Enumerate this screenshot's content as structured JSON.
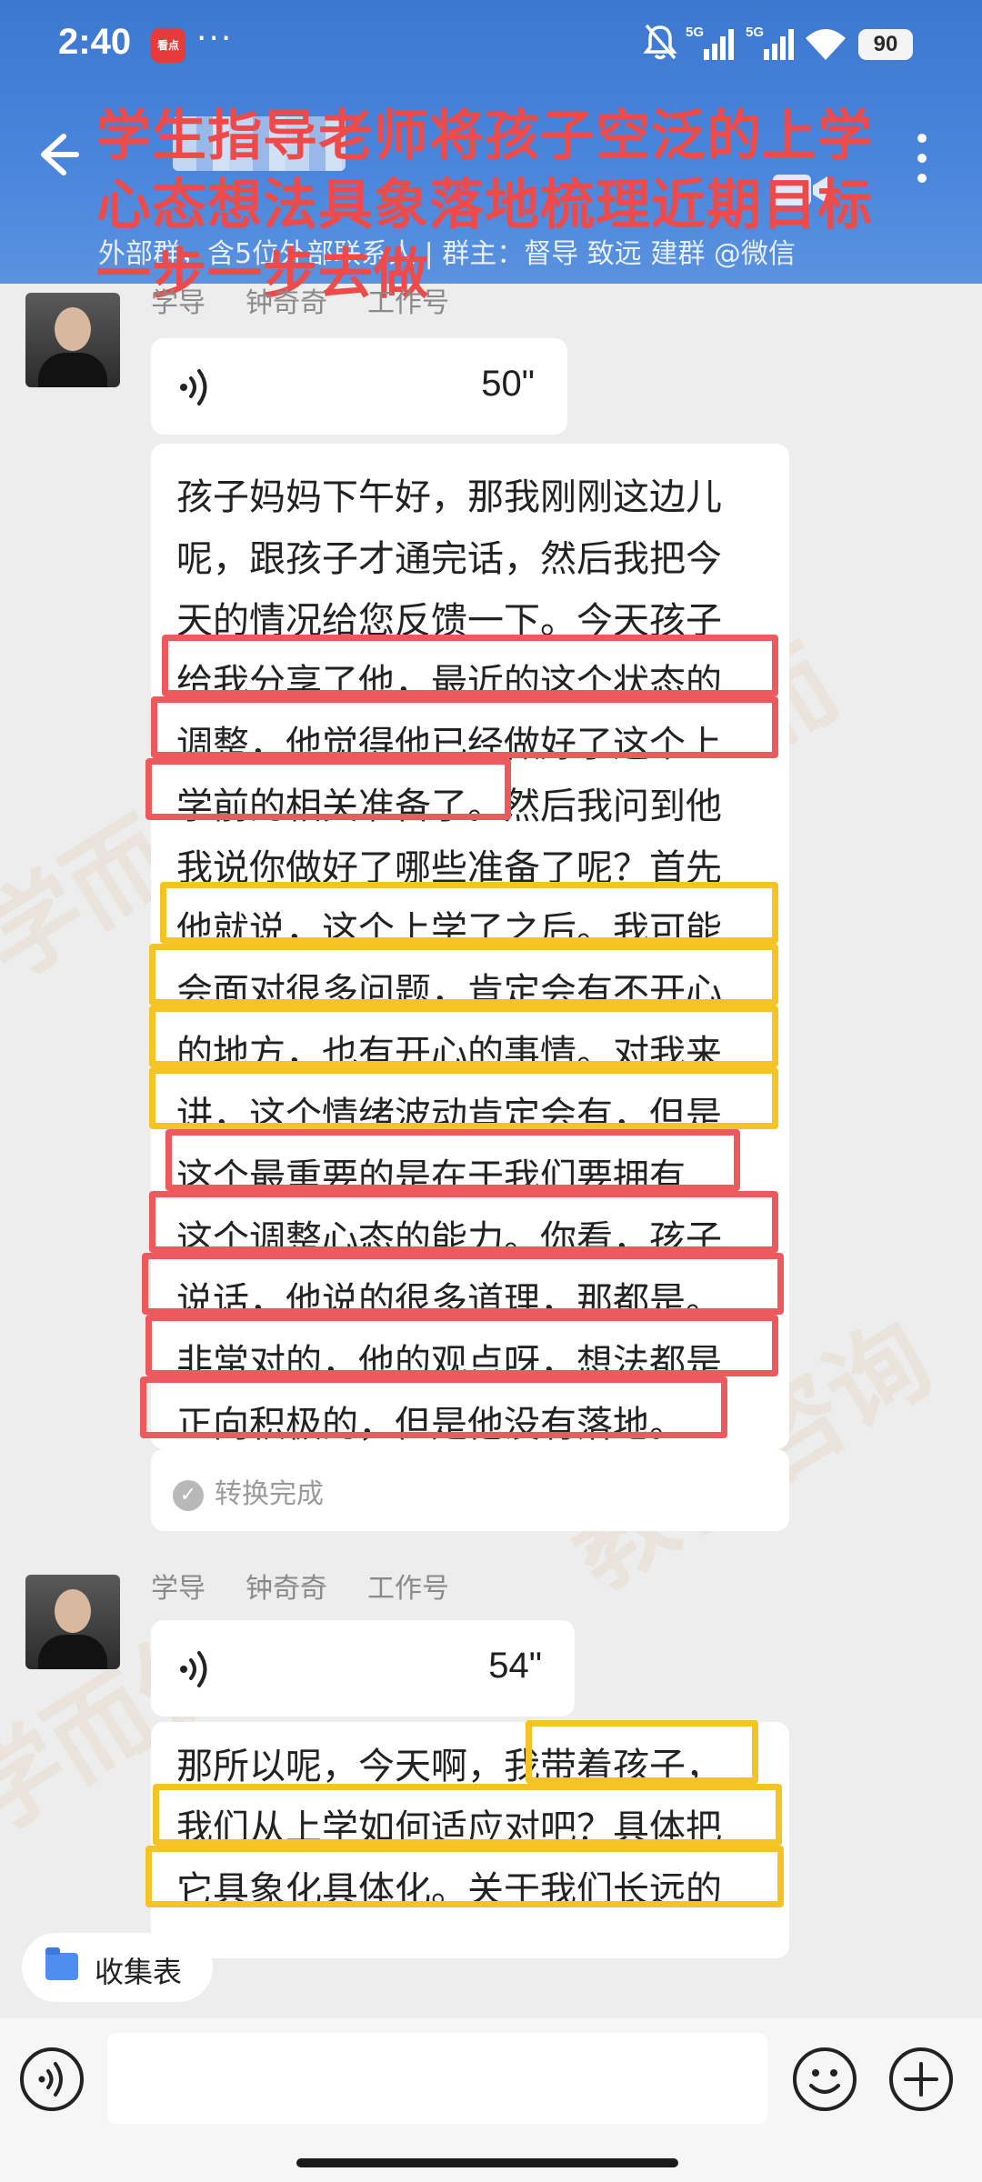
{
  "status_bar": {
    "time": "2:40",
    "app_badge": "看点",
    "more_dots": "···",
    "network1": "5G",
    "network2": "5G",
    "battery": "90"
  },
  "header": {
    "overlay_title": [
      "学生指导老师将孩子空泛的上学",
      "心态想法具象落地梳理近期目标",
      "一步一步去做"
    ],
    "subtitle": "外部群，含5位外部联系人 | 群主：督导 致远    建群 @微信"
  },
  "messages": [
    {
      "sender": {
        "role": "学导",
        "name": "钟奇奇",
        "tag": "工作号"
      },
      "voice_duration": "50\"",
      "transcript_lines": [
        "孩子妈妈下午好，那我刚刚这边儿",
        "呢，跟孩子才通完话，然后我把今",
        "天的情况给您反馈一下。今天孩子",
        "给我分享了他，最近的这个状态的",
        "调整，他觉得他已经做好了这个上",
        "学前的相关准备了。然后我问到他",
        "我说你做好了哪些准备了呢？首先",
        "他就说，这个上学了之后。我可能",
        "会面对很多问题，肯定会有不开心",
        "的地方，也有开心的事情。对我来",
        "讲，这个情绪波动肯定会有，但是",
        "这个最重要的是在于我们要拥有",
        "这个调整心态的能力。你看，孩子",
        "说话，他说的很多道理，那都是。",
        "非常对的，他的观点呀，想法都是",
        "正向积极的，但是他没有落地。"
      ],
      "status": "转换完成"
    },
    {
      "sender": {
        "role": "学导",
        "name": "钟奇奇",
        "tag": "工作号"
      },
      "voice_duration": "54\"",
      "transcript_lines": [
        "那所以呢，今天啊，我带着孩子，",
        "我们从上学如何适应对吧？具体把",
        "它具象化具体化。关于我们长远的"
      ]
    }
  ],
  "quick_action": {
    "label": "收集表"
  },
  "icons": {
    "back": "arrow-left-icon",
    "more": "more-vertical-icon",
    "video": "video-call-icon",
    "voice_input": "voice-input-icon",
    "emoji": "emoji-icon",
    "plus": "plus-icon"
  },
  "colors": {
    "header_blue": "#3c78d0",
    "annotation_red": "#ec5a5e",
    "annotation_yellow": "#f3c423",
    "overlay_text_red": "#ee4a4a"
  }
}
